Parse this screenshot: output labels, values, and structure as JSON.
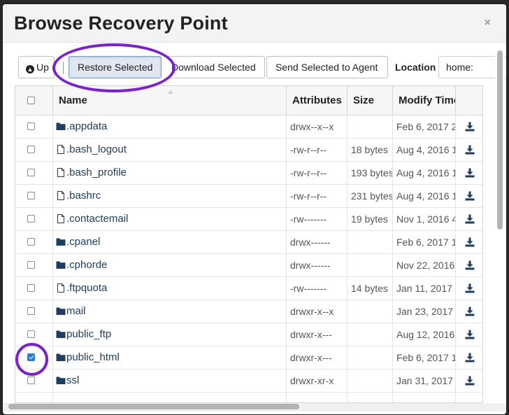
{
  "dialog": {
    "title": "Browse Recovery Point",
    "close_glyph": "×"
  },
  "toolbar": {
    "up_label": "Up",
    "restore_label": "Restore Selected",
    "download_label": "Download Selected",
    "send_label": "Send Selected to Agent",
    "location_label": "Location",
    "location_value": "home:"
  },
  "table": {
    "columns": [
      "Name",
      "Attributes",
      "Size",
      "Modify Time"
    ],
    "rows": [
      {
        "icon": "folder-icon",
        "name": ".appdata",
        "attributes": "drwx--x--x",
        "size": "",
        "modified": "Feb 6, 2017 2",
        "checked": false
      },
      {
        "icon": "file-icon",
        "name": ".bash_logout",
        "attributes": "-rw-r--r--",
        "size": "18 bytes",
        "modified": "Aug 4, 2016 1",
        "checked": false
      },
      {
        "icon": "file-icon",
        "name": ".bash_profile",
        "attributes": "-rw-r--r--",
        "size": "193 bytes",
        "modified": "Aug 4, 2016 1",
        "checked": false
      },
      {
        "icon": "file-icon",
        "name": ".bashrc",
        "attributes": "-rw-r--r--",
        "size": "231 bytes",
        "modified": "Aug 4, 2016 1",
        "checked": false
      },
      {
        "icon": "file-icon",
        "name": ".contactemail",
        "attributes": "-rw-------",
        "size": "19 bytes",
        "modified": "Nov 1, 2016 4",
        "checked": false
      },
      {
        "icon": "folder-icon",
        "name": ".cpanel",
        "attributes": "drwx------",
        "size": "",
        "modified": "Feb 6, 2017 1",
        "checked": false
      },
      {
        "icon": "folder-icon",
        "name": ".cphorde",
        "attributes": "drwx------",
        "size": "",
        "modified": "Nov 22, 2016",
        "checked": false
      },
      {
        "icon": "file-icon",
        "name": ".ftpquota",
        "attributes": "-rw-------",
        "size": "14 bytes",
        "modified": "Jan 11, 2017",
        "checked": false
      },
      {
        "icon": "folder-icon",
        "name": "mail",
        "attributes": "drwxr-x--x",
        "size": "",
        "modified": "Jan 23, 2017",
        "checked": false
      },
      {
        "icon": "folder-icon",
        "name": "public_ftp",
        "attributes": "drwxr-x---",
        "size": "",
        "modified": "Aug 12, 2016",
        "checked": false
      },
      {
        "icon": "folder-icon",
        "name": "public_html",
        "attributes": "drwxr-x---",
        "size": "",
        "modified": "Feb 6, 2017 1",
        "checked": true
      },
      {
        "icon": "folder-icon",
        "name": "ssl",
        "attributes": "drwxr-xr-x",
        "size": "",
        "modified": "Jan 31, 2017",
        "checked": false
      }
    ]
  },
  "colors": {
    "annotation": "#7c1ed6",
    "link": "#1d3d63",
    "checkbox_checked": "#1c7cf0"
  }
}
